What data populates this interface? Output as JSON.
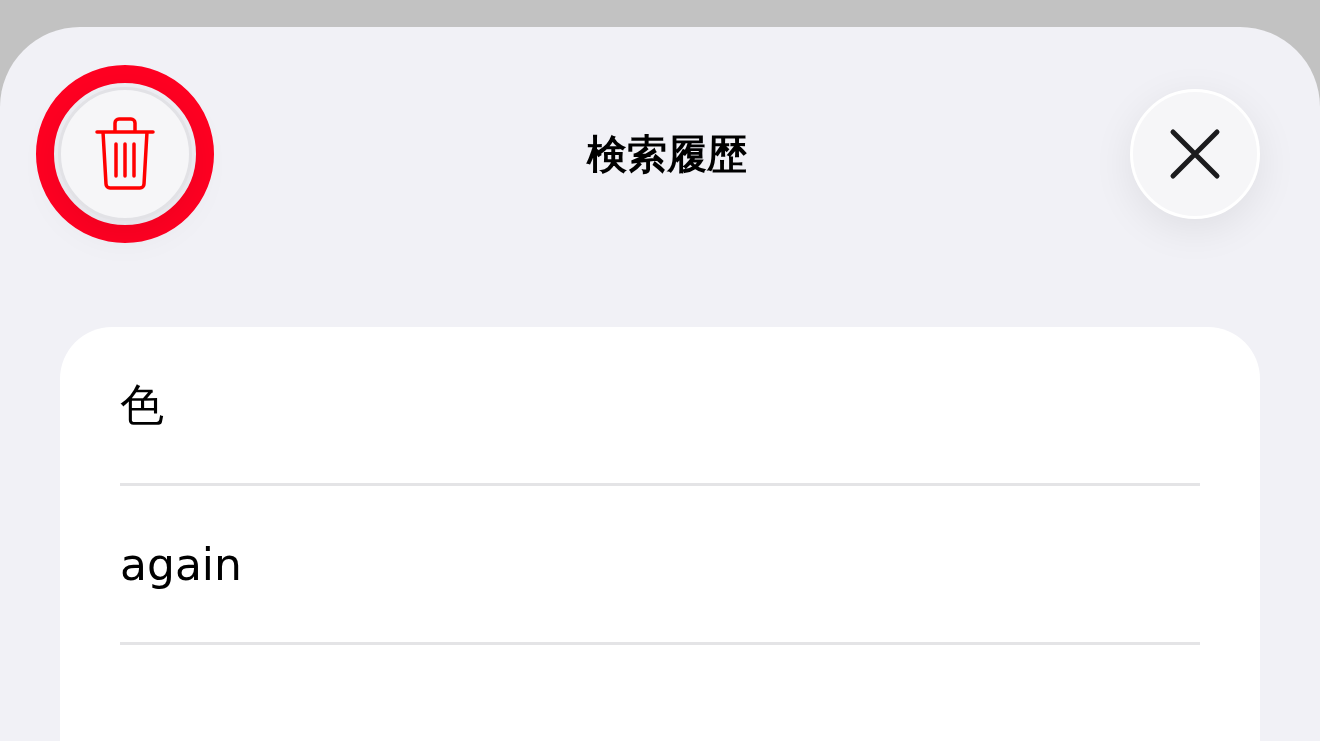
{
  "header": {
    "title": "検索履歴",
    "delete_button": {
      "highlighted": true
    }
  },
  "history": [
    {
      "text": "色"
    },
    {
      "text": "again"
    }
  ]
}
